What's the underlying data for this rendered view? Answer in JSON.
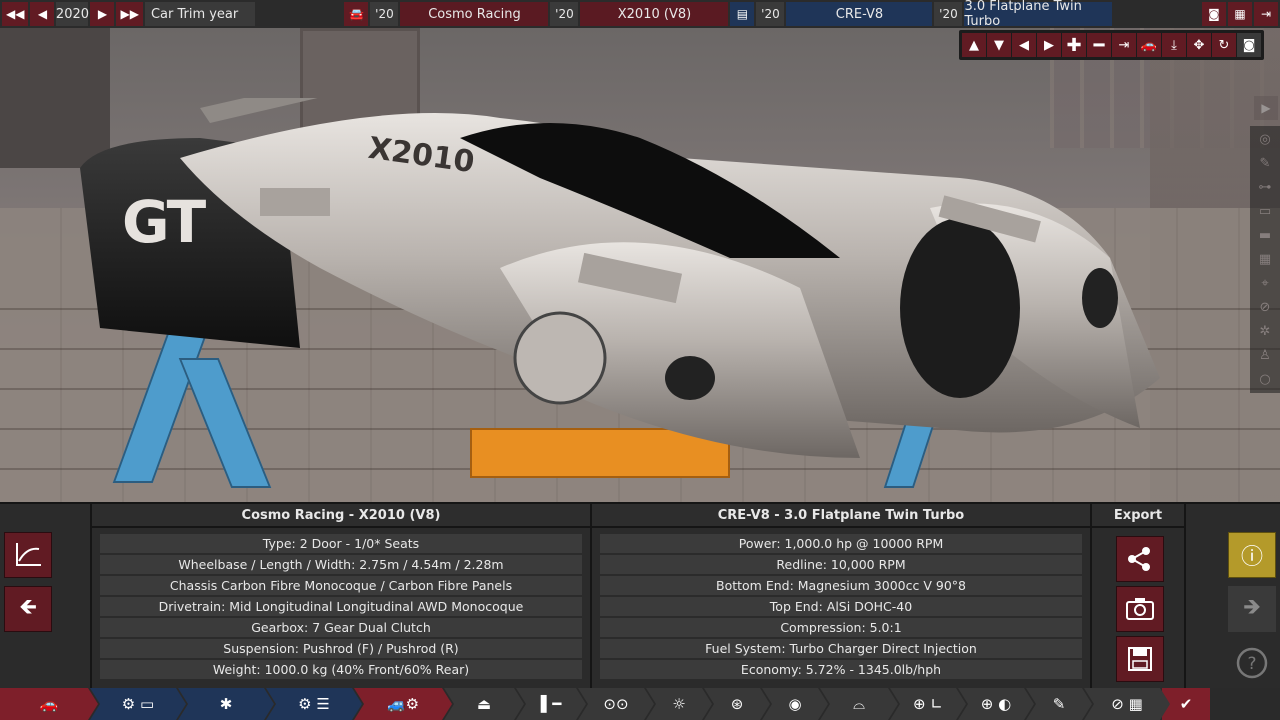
{
  "topbar": {
    "year": "2020",
    "car_trim_year_label": "Car Trim year",
    "model_year": "'20",
    "brand": "Cosmo Racing",
    "trim_year": "'20",
    "model": "X2010 (V8)",
    "engine_family_year": "'20",
    "engine_family": "CRE-V8",
    "engine_variant_year": "'20",
    "engine_variant": "3.0 Flatplane Twin Turbo"
  },
  "car_panel": {
    "title": "Cosmo Racing - X2010 (V8)",
    "rows": [
      "Type: 2 Door - 1/0* Seats",
      "Wheelbase / Length / Width: 2.75m / 4.54m / 2.28m",
      "Chassis Carbon Fibre Monocoque / Carbon Fibre Panels",
      "Drivetrain: Mid Longitudinal Longitudinal AWD Monocoque",
      "Gearbox: 7 Gear Dual Clutch",
      "Suspension: Pushrod (F) / Pushrod (R)",
      "Weight: 1000.0 kg (40% Front/60% Rear)"
    ]
  },
  "engine_panel": {
    "title": "CRE-V8 - 3.0 Flatplane Twin Turbo",
    "rows": [
      "Power: 1,000.0 hp @ 10000 RPM",
      "Redline:  10,000 RPM",
      "Bottom End: Magnesium 3000cc V 90°8",
      "Top End: AlSi DOHC-40",
      "Compression: 5.0:1",
      "Fuel System: Turbo Charger Direct Injection",
      "Economy: 5.72% - 1345.0lb/hph"
    ]
  },
  "export": {
    "title": "Export"
  },
  "scene": {
    "car_decal": "GT",
    "car_number": "X2010"
  },
  "colors": {
    "accent": "#611b23",
    "navy": "#1f3558",
    "warning": "#b49a2a"
  }
}
